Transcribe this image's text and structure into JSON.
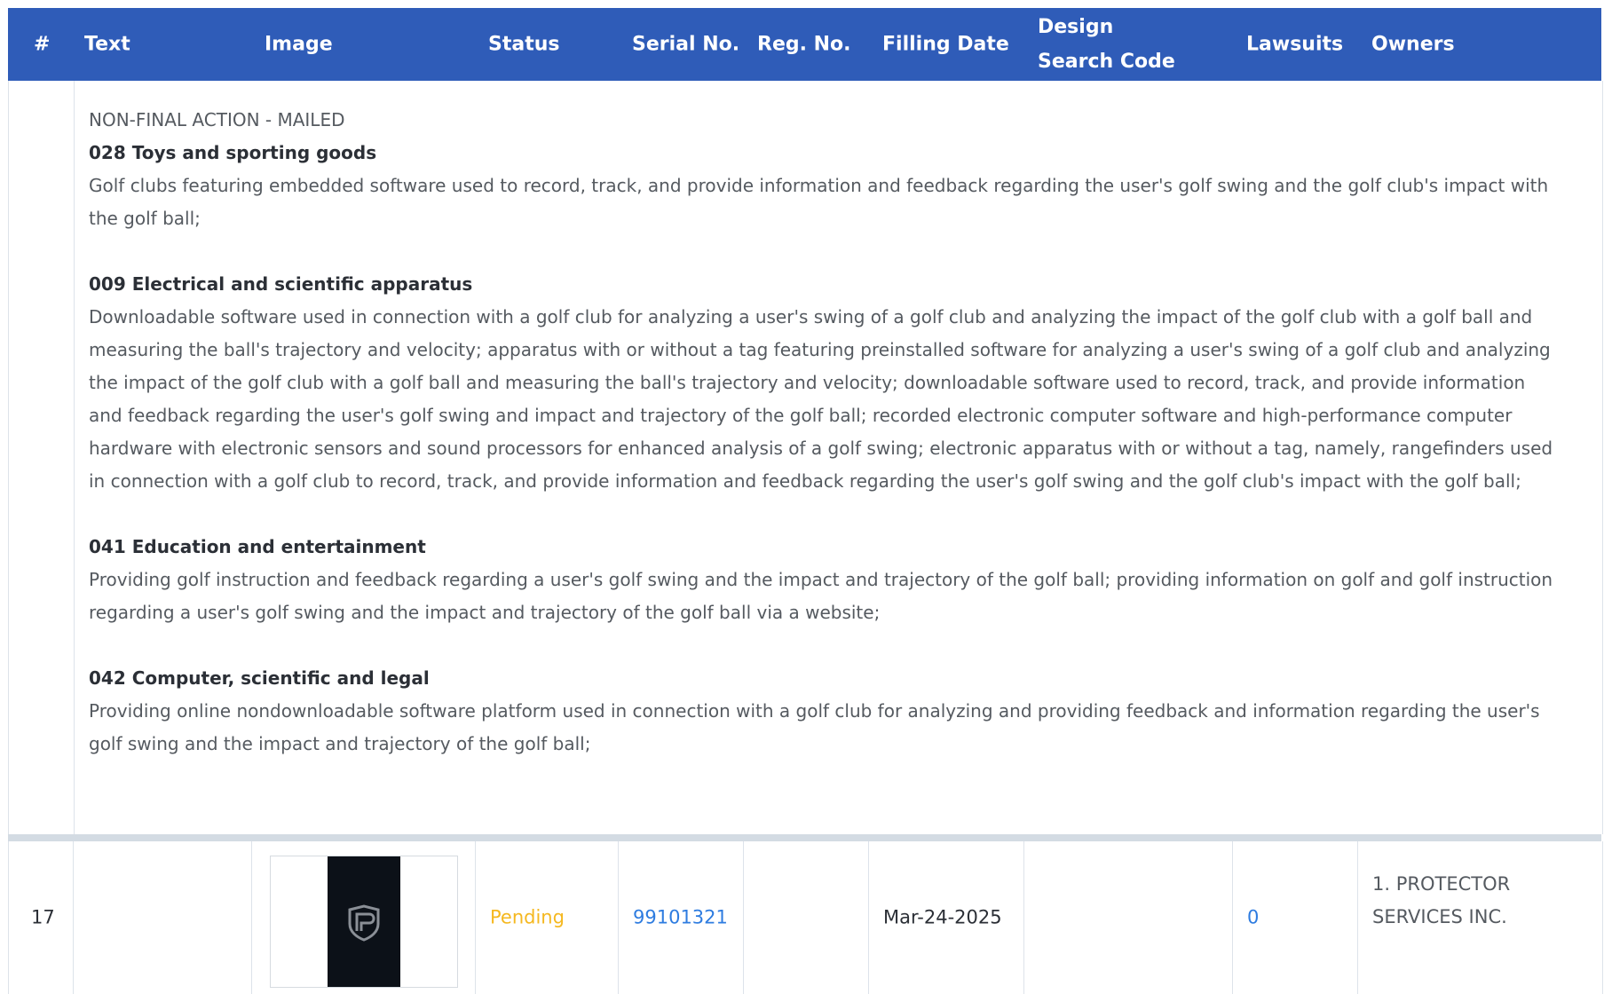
{
  "header": {
    "col_num": "#",
    "col_text": "Text",
    "col_image": "Image",
    "col_status": "Status",
    "col_serial": "Serial No.",
    "col_reg": "Reg. No.",
    "col_filing": "Filling Date",
    "col_design": "Design Search Code",
    "col_lawsuits": "Lawsuits",
    "col_owners": "Owners"
  },
  "detail": {
    "status": "NON-FINAL ACTION - MAILED",
    "classes": [
      {
        "title": "028 Toys and sporting goods",
        "description": "Golf clubs featuring embedded software used to record, track, and provide information and feedback regarding the user's golf swing and the golf club's impact with the golf ball;"
      },
      {
        "title": "009 Electrical and scientific apparatus",
        "description": "Downloadable software used in connection with a golf club for analyzing a user's swing of a golf club and analyzing the impact of the golf club with a golf ball and measuring the ball's trajectory and velocity; apparatus with or without a tag featuring preinstalled software for analyzing a user's swing of a golf club and analyzing the impact of the golf club with a golf ball and measuring the ball's trajectory and velocity; downloadable software used to record, track, and provide information and feedback regarding the user's golf swing and impact and trajectory of the golf ball; recorded electronic computer software and high-performance computer hardware with electronic sensors and sound processors for enhanced analysis of a golf swing; electronic apparatus with or without a tag, namely, rangefinders used in connection with a golf club to record, track, and provide information and feedback regarding the user's golf swing and the golf club's impact with the golf ball;"
      },
      {
        "title": "041 Education and entertainment",
        "description": "Providing golf instruction and feedback regarding a user's golf swing and the impact and trajectory of the golf ball; providing information on golf and golf instruction regarding a user's golf swing and the impact and trajectory of the golf ball via a website;"
      },
      {
        "title": "042 Computer, scientific and legal",
        "description": "Providing online nondownloadable software platform used in connection with a golf club for analyzing and providing feedback and information regarding the user's golf swing and the impact and trajectory of the golf ball;"
      }
    ]
  },
  "row": {
    "number": "17",
    "text": "",
    "image_icon": "protector-shield-logo",
    "status": "Pending",
    "serial": "99101321",
    "reg": "",
    "filing_date": "Mar-24-2025",
    "design_code": "",
    "lawsuits": "0",
    "owners": "1. PROTECTOR SERVICES INC."
  },
  "colors": {
    "header_bg": "#2f5cb8",
    "pending": "#f5b820",
    "link": "#2e7ce0"
  }
}
